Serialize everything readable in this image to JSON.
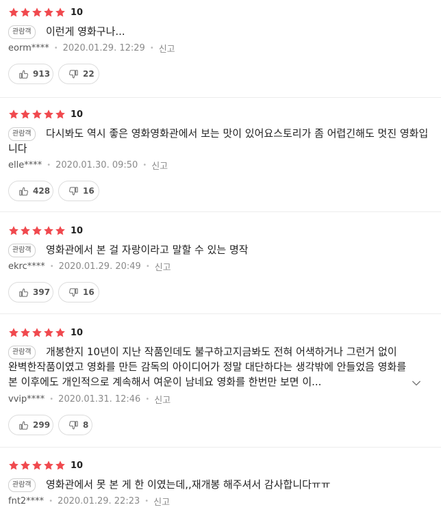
{
  "reviews": [
    {
      "score": "10",
      "badge": "관람객",
      "text": "이런게 영화구나...",
      "user": "eorm****",
      "date": "2020.01.29. 12:29",
      "report": "신고",
      "likes": "913",
      "dislikes": "22"
    },
    {
      "score": "10",
      "badge": "관람객",
      "text": "다시봐도 역시 좋은 영화영화관에서 보는 맛이 있어요스토리가 좀 어렵긴해도 멋진 영화입니다",
      "user": "elle****",
      "date": "2020.01.30. 09:50",
      "report": "신고",
      "likes": "428",
      "dislikes": "16"
    },
    {
      "score": "10",
      "badge": "관람객",
      "text": "영화관에서 본 걸 자랑이라고 말할 수 있는 명작",
      "user": "ekrc****",
      "date": "2020.01.29. 20:49",
      "report": "신고",
      "likes": "397",
      "dislikes": "16"
    },
    {
      "score": "10",
      "badge": "관람객",
      "text": "개봉한지 10년이 지난 작품인데도 불구하고지금봐도 전혀 어색하거나 그런거 없이 완벽한작품이였고 영화를 만든 감독의 아이디어가 정말 대단하다는 생각밖에 안들었음 영화를 본 이후에도 개인적으로 계속해서 여운이 남네요 영화를 한번만 보면 이...",
      "user": "vvip****",
      "date": "2020.01.31. 12:46",
      "report": "신고",
      "likes": "299",
      "dislikes": "8"
    },
    {
      "score": "10",
      "badge": "관람객",
      "text": "영화관에서 못 본 게 한 이였는데,,재개봉 해주셔서 감사합니다ㅠㅠ",
      "user": "fnt2****",
      "date": "2020.01.29. 22:23",
      "report": "신고"
    }
  ],
  "colors": {
    "star": "#f0494e",
    "text": "#222222",
    "meta": "#8a8a8a",
    "border": "#dcdcdc"
  },
  "icons": {
    "star": "star-icon",
    "like": "thumbs-up-icon",
    "dislike": "thumbs-down-icon",
    "more": "chevron-down-icon"
  }
}
